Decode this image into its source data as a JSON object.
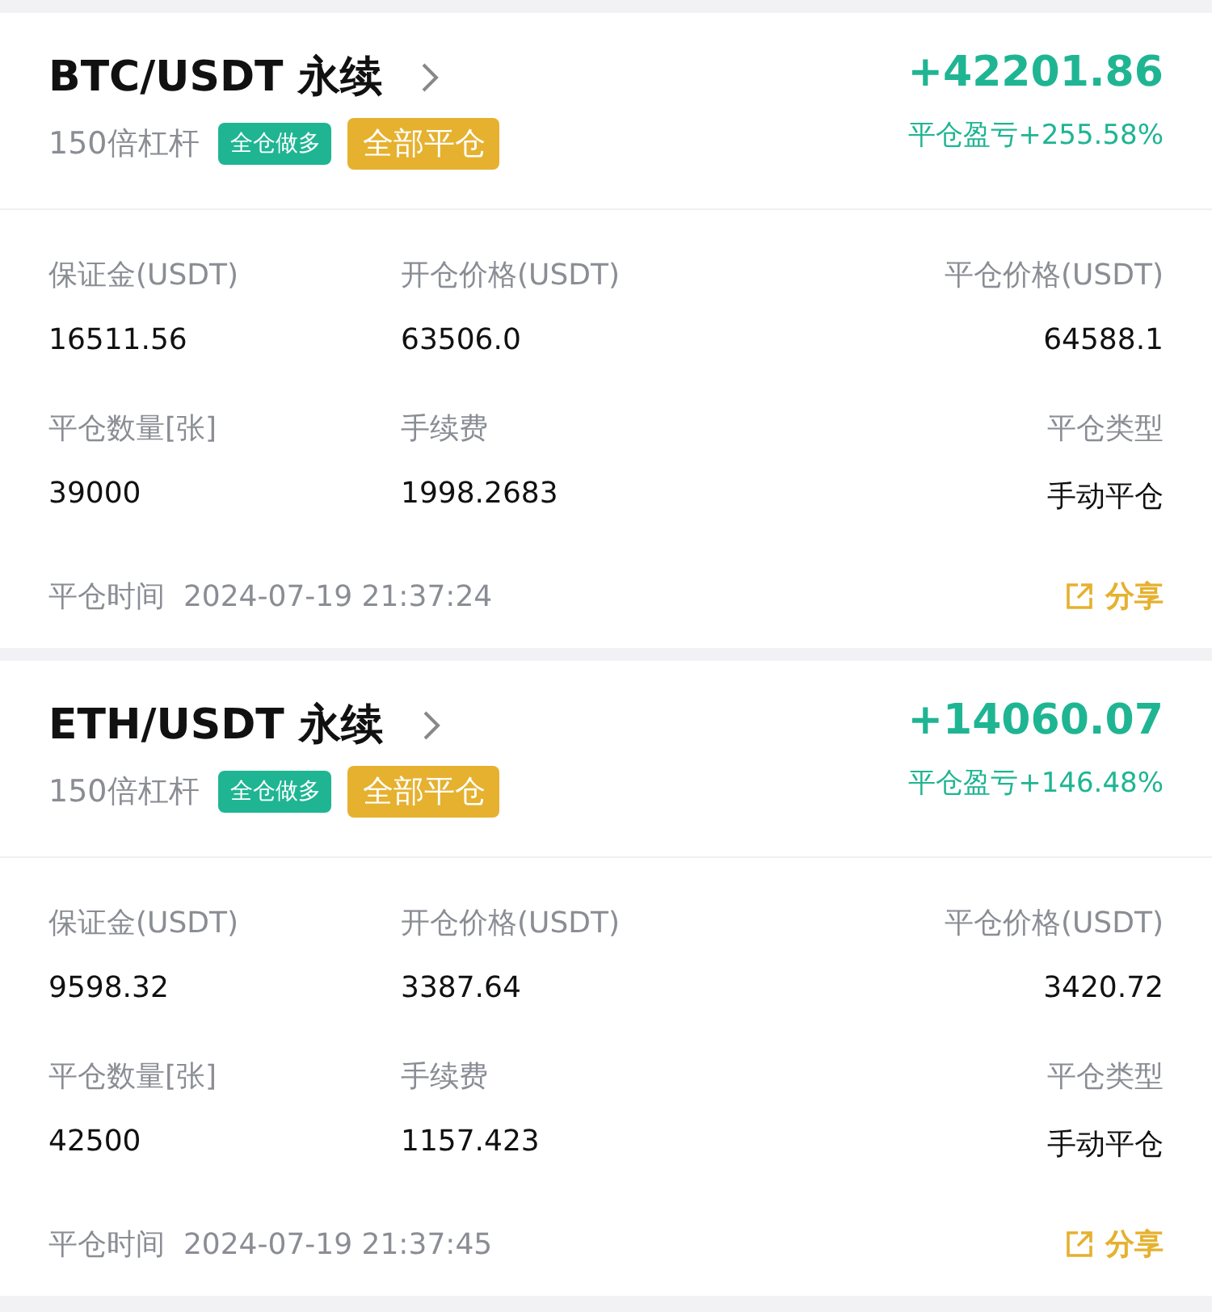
{
  "positions": [
    {
      "symbol": "BTC/USDT 永续",
      "leverage": "150倍杠杆",
      "mode_tag": "全仓做多",
      "close_tag": "全部平仓",
      "pnl": "+42201.86",
      "pnl_label": "平仓盈亏",
      "pnl_pct": "+255.58%",
      "fields": [
        {
          "label": "保证金(USDT)",
          "value": "16511.56"
        },
        {
          "label": "开仓价格(USDT)",
          "value": "63506.0"
        },
        {
          "label": "平仓价格(USDT)",
          "value": "64588.1"
        },
        {
          "label": "平仓数量[张]",
          "value": "39000"
        },
        {
          "label": "手续费",
          "value": "1998.2683"
        },
        {
          "label": "平仓类型",
          "value": "手动平仓"
        }
      ],
      "time_label": "平仓时间",
      "time": "2024-07-19 21:37:24",
      "share": "分享"
    },
    {
      "symbol": "ETH/USDT 永续",
      "leverage": "150倍杠杆",
      "mode_tag": "全仓做多",
      "close_tag": "全部平仓",
      "pnl": "+14060.07",
      "pnl_label": "平仓盈亏",
      "pnl_pct": "+146.48%",
      "fields": [
        {
          "label": "保证金(USDT)",
          "value": "9598.32"
        },
        {
          "label": "开仓价格(USDT)",
          "value": "3387.64"
        },
        {
          "label": "平仓价格(USDT)",
          "value": "3420.72"
        },
        {
          "label": "平仓数量[张]",
          "value": "42500"
        },
        {
          "label": "手续费",
          "value": "1157.423"
        },
        {
          "label": "平仓类型",
          "value": "手动平仓"
        }
      ],
      "time_label": "平仓时间",
      "time": "2024-07-19 21:37:45",
      "share": "分享"
    }
  ]
}
